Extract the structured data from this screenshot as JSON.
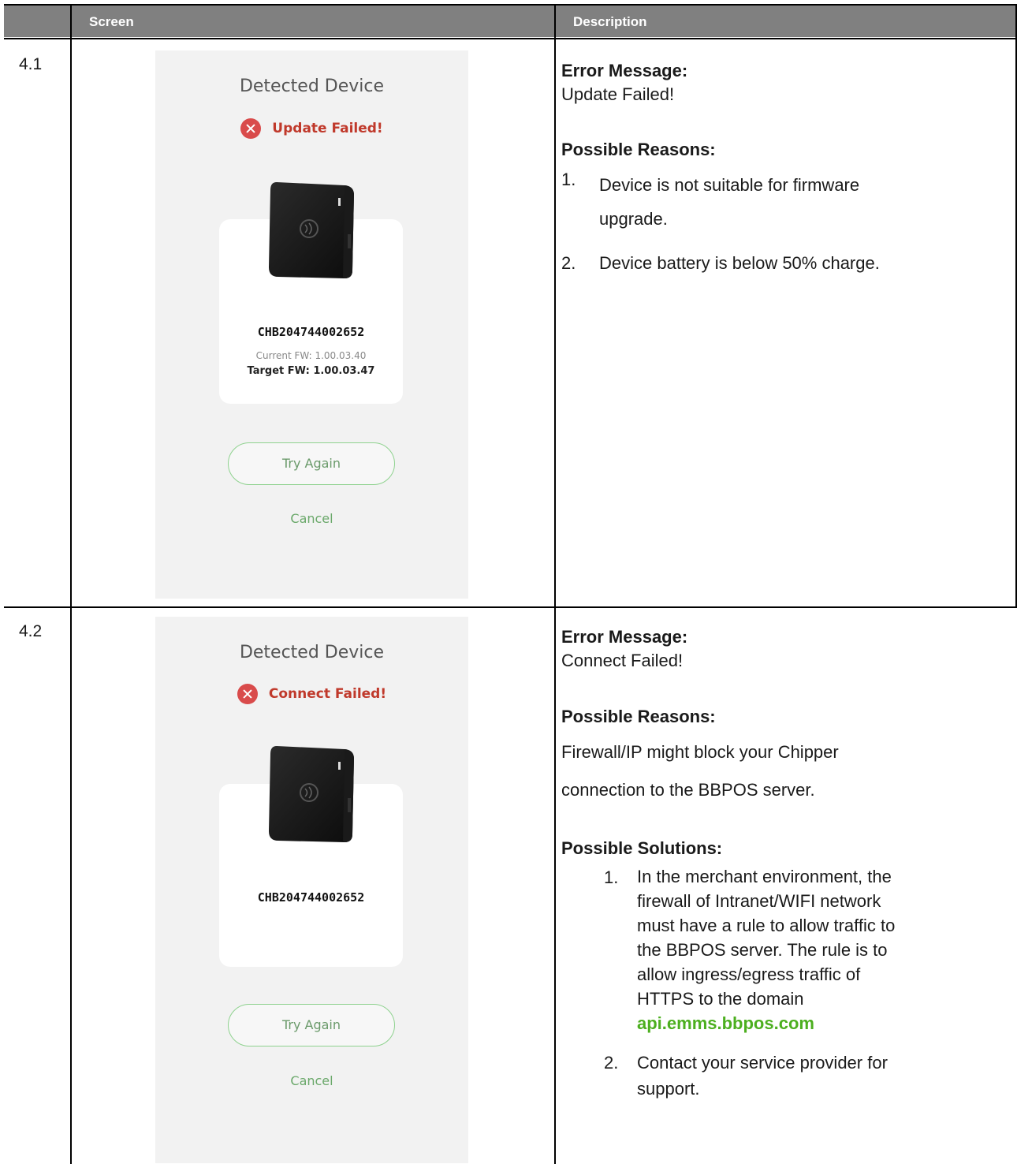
{
  "table": {
    "headers": {
      "screen": "Screen",
      "description": "Description"
    },
    "rows": [
      {
        "number": "4.1",
        "screen": {
          "title": "Detected Device",
          "status_text": "Update Failed!",
          "serial": "CHB204744002652",
          "current_fw": "Current FW: 1.00.03.40",
          "target_fw": "Target FW: 1.00.03.47",
          "try_again": "Try Again",
          "cancel": "Cancel"
        },
        "description": {
          "error_heading": "Error Message:",
          "error_text": "Update Failed!",
          "reasons_heading": "Possible Reasons:",
          "reasons": [
            {
              "num": "1.",
              "line1": "Device is not suitable for firmware",
              "line2": "upgrade."
            },
            {
              "num": "2.",
              "line1": "Device battery is below 50% charge."
            }
          ]
        }
      },
      {
        "number": "4.2",
        "screen": {
          "title": "Detected Device",
          "status_text": "Connect Failed!",
          "serial": "CHB204744002652",
          "try_again": "Try Again",
          "cancel": "Cancel"
        },
        "description": {
          "error_heading": "Error Message:",
          "error_text": "Connect Failed!",
          "reasons_heading": "Possible Reasons:",
          "reason_line1": "Firewall/IP might block your Chipper",
          "reason_line2": "connection to the BBPOS server.",
          "solutions_heading": "Possible Solutions:",
          "solutions": [
            {
              "num": "1.",
              "lines": [
                "In the merchant environment, the",
                "firewall of Intranet/WIFI network",
                "must have a rule to allow traffic to",
                "the BBPOS server. The rule is to",
                "allow ingress/egress traffic of",
                "HTTPS to the domain"
              ],
              "domain": "api.emms.bbpos.com"
            },
            {
              "num": "2.",
              "lines": [
                "Contact your service provider for",
                "support."
              ]
            }
          ]
        }
      }
    ]
  },
  "colors": {
    "header_bg": "#808080",
    "error_red": "#d94b4b",
    "link_green": "#4caf1f",
    "button_border": "#8fd28f"
  }
}
